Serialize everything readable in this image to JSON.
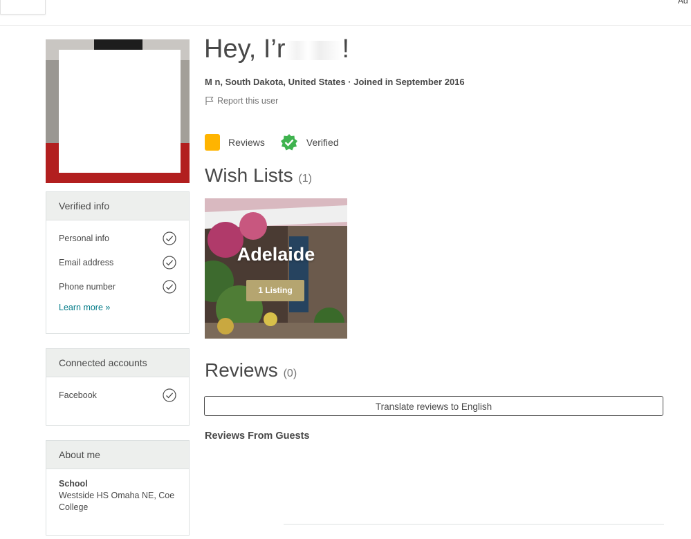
{
  "header": {
    "top_link": "Ad"
  },
  "profile": {
    "greeting": "Hey, I’r",
    "greeting_tail": "!",
    "location_line": "M     n, South Dakota, United States · Joined in September 2016",
    "report_label": "Report this user"
  },
  "badges": {
    "reviews_label": "Reviews",
    "verified_label": "Verified"
  },
  "verified_info": {
    "title": "Verified info",
    "items": [
      {
        "label": "Personal info",
        "icon": "check-circle-icon"
      },
      {
        "label": "Email address",
        "icon": "check-circle-icon"
      },
      {
        "label": "Phone number",
        "icon": "check-circle-icon"
      }
    ],
    "learn_more": "Learn more »"
  },
  "connected_accounts": {
    "title": "Connected accounts",
    "items": [
      {
        "label": "Facebook",
        "icon": "check-circle-icon"
      }
    ]
  },
  "about_me": {
    "title": "About me",
    "school_label": "School",
    "school_value": "Westside HS Omaha NE, Coe College"
  },
  "wish_lists": {
    "title": "Wish Lists",
    "count": "(1)",
    "cards": [
      {
        "name": "Adelaide",
        "listing_count": "1 Listing"
      }
    ]
  },
  "reviews": {
    "title": "Reviews",
    "count": "(0)",
    "translate_button": "Translate reviews to English",
    "from_guests": "Reviews From Guests"
  },
  "colors": {
    "accent_teal": "#007a87",
    "badge_yellow": "#ffb400",
    "verified_green": "#3fb34f",
    "panel_header_bg": "#edefed",
    "listing_pill": "#b5a570"
  }
}
